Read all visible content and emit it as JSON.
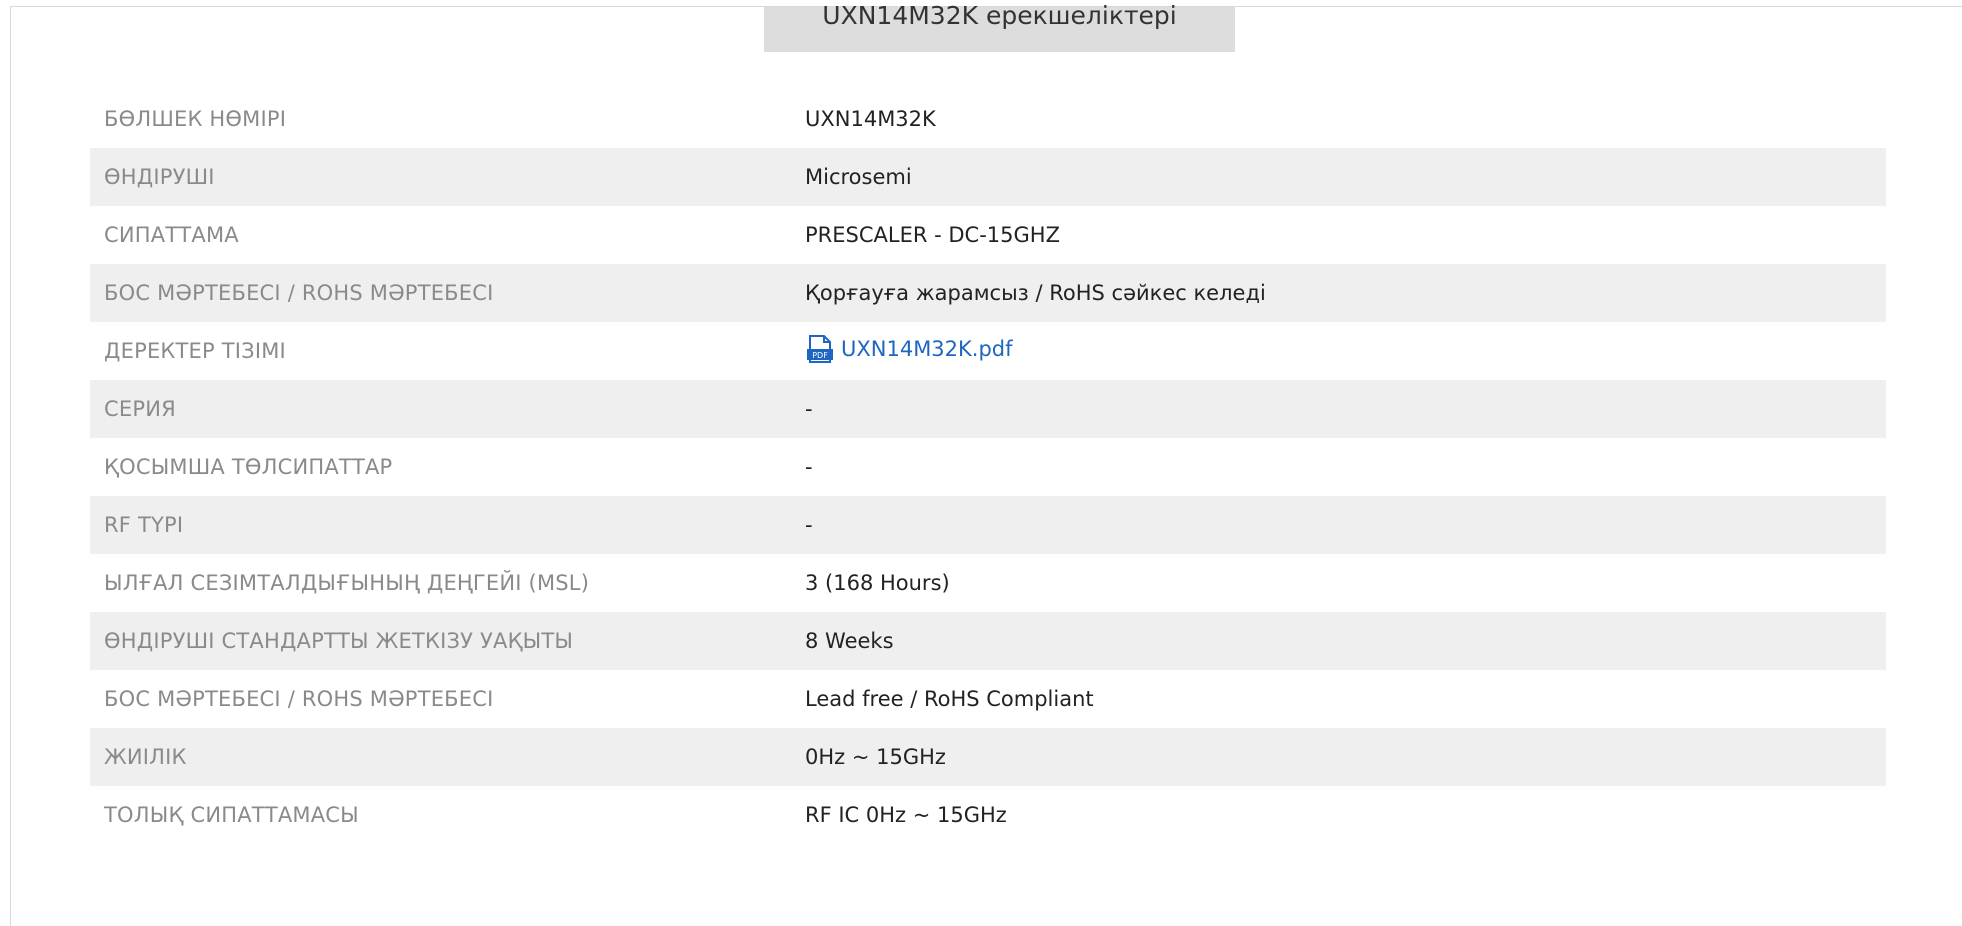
{
  "section": {
    "title": "UXN14M32K ерекшеліктері"
  },
  "specs": [
    {
      "label": "БӨЛШЕК НӨМІРІ",
      "value": "UXN14M32K"
    },
    {
      "label": "ӨНДІРУШІ",
      "value": "Microsemi"
    },
    {
      "label": "СИПАТТАМА",
      "value": "PRESCALER - DC-15GHZ"
    },
    {
      "label": "БОС МӘРТЕБЕСІ / ROHS МӘРТЕБЕСІ",
      "value": "Қорғауға жарамсыз / RoHS сәйкес келеді"
    },
    {
      "label": "ДЕРЕКТЕР ТІЗІМІ",
      "value": "UXN14M32K.pdf",
      "icon": "pdf-icon"
    },
    {
      "label": "СЕРИЯ",
      "value": "-"
    },
    {
      "label": "ҚОСЫМША ТӨЛСИПАТТАР",
      "value": "-"
    },
    {
      "label": "RF ТҮРІ",
      "value": "-"
    },
    {
      "label": "ЫЛҒАЛ СЕЗІМТАЛДЫҒЫНЫҢ ДЕҢГЕЙІ (MSL)",
      "value": "3 (168 Hours)"
    },
    {
      "label": "ӨНДІРУШІ СТАНДАРТТЫ ЖЕТКІЗУ УАҚЫТЫ",
      "value": "8 Weeks"
    },
    {
      "label": "БОС МӘРТЕБЕСІ / ROHS МӘРТЕБЕСІ",
      "value": "Lead free / RoHS Compliant"
    },
    {
      "label": "ЖИІЛІК",
      "value": "0Hz ~ 15GHz"
    },
    {
      "label": "ТОЛЫҚ СИПАТТАМАСЫ",
      "value": "RF IC 0Hz ~ 15GHz"
    }
  ],
  "colors": {
    "link": "#1d66c1",
    "stripe": "#efefef",
    "label_text": "#8a8a8a",
    "value_text": "#222222",
    "title_bg": "#dddddd"
  }
}
